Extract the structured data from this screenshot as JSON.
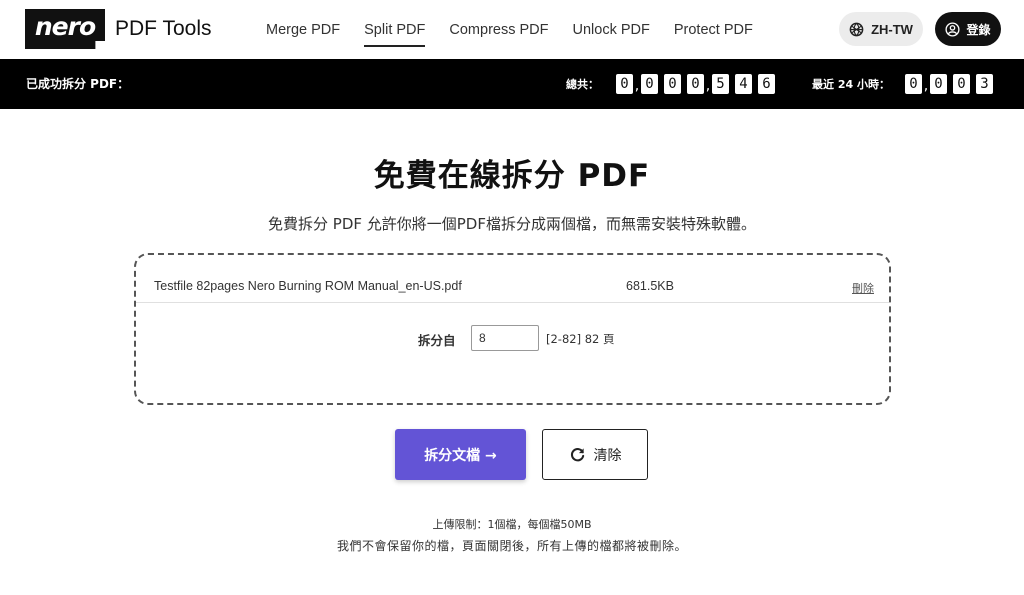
{
  "header": {
    "logo_mark": "nero",
    "logo_text": "PDF Tools",
    "nav": [
      {
        "label": "Merge PDF"
      },
      {
        "label": "Split PDF",
        "active": true
      },
      {
        "label": "Compress PDF"
      },
      {
        "label": "Unlock PDF"
      },
      {
        "label": "Protect PDF"
      }
    ],
    "lang_label": "ZH-TW",
    "login_label": "登錄"
  },
  "stats": {
    "title": "已成功拆分 PDF：",
    "total_label": "總共：",
    "total_digits": [
      "0",
      "0",
      "0",
      "0",
      "5",
      "4",
      "6"
    ],
    "recent_label": "最近 24 小時：",
    "recent_digits": [
      "0",
      "0",
      "0",
      "3"
    ]
  },
  "main": {
    "title": "免費在線拆分 PDF",
    "subtitle": "免費拆分 PDF 允許你將一個PDF檔拆分成兩個檔，而無需安裝特殊軟體。",
    "file": {
      "name": "Testfile 82pages Nero Burning ROM Manual_en-US.pdf",
      "size": "681.5KB",
      "delete_label": "刪除"
    },
    "split": {
      "label": "拆分自",
      "value": "8",
      "range": "[2-82] 82 頁"
    },
    "split_button": "拆分文檔 →",
    "clear_button": "清除",
    "limit_note": "上傳限制：1個檔，每個檔50MB",
    "privacy_note": "我們不會保留你的檔，頁面關閉後，所有上傳的檔都將被刪除。"
  },
  "colors": {
    "accent": "#6354d6",
    "stats_bar": "#000000"
  }
}
